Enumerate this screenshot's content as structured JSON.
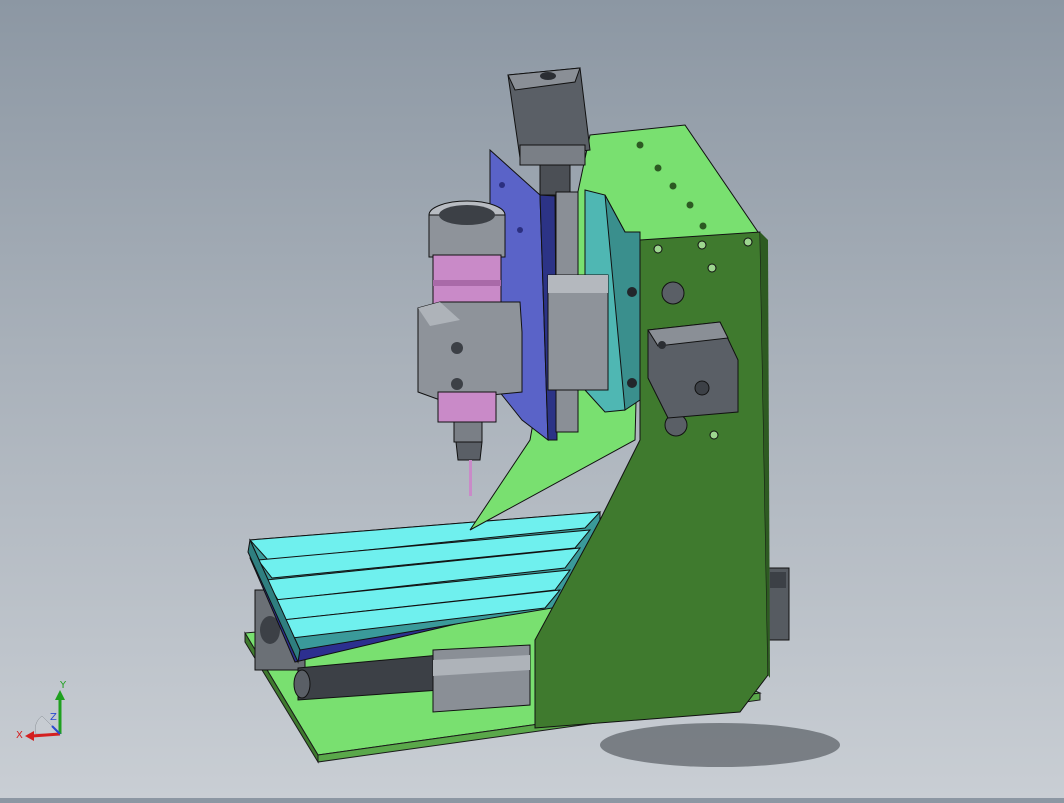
{
  "view": {
    "background_top": "#8c97a3",
    "background_bottom": "#c9ced4"
  },
  "model": {
    "colors": {
      "frame_light": "#79e070",
      "frame_dark": "#3f7a2e",
      "table_top": "#6ff0ee",
      "table_side": "#3a9a9a",
      "z_plate": "#5a63c8",
      "spindle": "#c98ac8",
      "metal": "#7a7f86",
      "metal_dark": "#3c4046"
    }
  },
  "triad": {
    "x_label": "X",
    "y_label": "Y",
    "z_label": "Z",
    "x_color": "#d42020",
    "y_color": "#1fa01f",
    "z_color": "#2a4ad0"
  }
}
